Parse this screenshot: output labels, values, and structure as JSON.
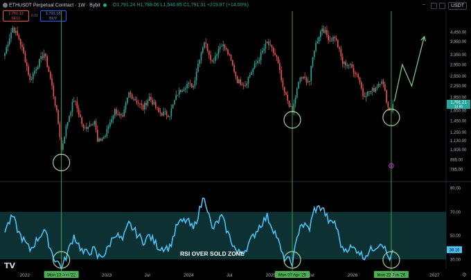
{
  "header": {
    "symbol": "ETHUSDT Perpetual Contract · 1W · Bybit",
    "ohlc": "O1,791.24 H1,788.06 L1,546.85 C1,791.31 +219.97 (+14.00%)"
  },
  "trade": {
    "sell_price": "1,791.13",
    "sell_label": "SELL",
    "buy_price": "1,791.18",
    "buy_label": "BUY",
    "spread": "0.01"
  },
  "toolbar": {
    "currency": "USDT",
    "minus": "−"
  },
  "settings_icon": "gear-icon",
  "colors": {
    "up": "#26a69a",
    "down": "#ef5350",
    "rsi": "#4fc3f7",
    "zone": "#0f3a3c",
    "vline": "#4caf50",
    "circle": "#a5d6a7",
    "arrow": "#81c784",
    "badge": "#4caf50",
    "pink": "#e040fb"
  },
  "chart_data": [
    {
      "type": "candlestick",
      "scale": "log",
      "ylim": [
        695,
        5600
      ],
      "y_ticks": [
        4450,
        3950,
        3350,
        2950,
        2550,
        2250,
        1950,
        1650,
        1450,
        1250,
        1130,
        1005,
        885,
        785
      ],
      "y_tick_labels": [
        "4,450.00",
        "3,950.00",
        "3,350.00",
        "2,950.00",
        "2,550.00",
        "2,250.00",
        "1,950.00",
        "1,650.00",
        "1,450.00",
        "1,250.00",
        "1,130.00",
        "1,005.00",
        "885.00",
        "785.00"
      ],
      "current_price": "1,791.21",
      "countdown": "1d 8h",
      "xlim": [
        "2021-10-01",
        "2027-02-15"
      ],
      "x_ticks": [
        "2022-01-01",
        "2022-07-01",
        "2023-01-01",
        "2023-07-01",
        "2024-01-01",
        "2024-07-01",
        "2025-01-01",
        "2025-07-01",
        "2026-01-01",
        "2026-07-01",
        "2027-01-01"
      ],
      "x_tick_labels": [
        "2022",
        "Jul",
        "2023",
        "Jul",
        "2024",
        "Jul",
        "2025",
        "Jul",
        "2026",
        "Jul",
        "2027"
      ],
      "anchors": [
        [
          "2021-10-04",
          3400
        ],
        [
          "2021-11-08",
          4700
        ],
        [
          "2021-12-06",
          4100
        ],
        [
          "2022-01-24",
          2400
        ],
        [
          "2022-03-28",
          3400
        ],
        [
          "2022-05-09",
          2000
        ],
        [
          "2022-06-13",
          1000
        ],
        [
          "2022-06-20",
          1100
        ],
        [
          "2022-08-08",
          1900
        ],
        [
          "2022-09-19",
          1300
        ],
        [
          "2022-11-07",
          1450
        ],
        [
          "2022-11-21",
          1100
        ],
        [
          "2022-12-26",
          1200
        ],
        [
          "2023-02-06",
          1650
        ],
        [
          "2023-03-13",
          1480
        ],
        [
          "2023-04-10",
          2050
        ],
        [
          "2023-06-12",
          1700
        ],
        [
          "2023-07-10",
          1950
        ],
        [
          "2023-08-21",
          1600
        ],
        [
          "2023-10-09",
          1570
        ],
        [
          "2023-11-13",
          2050
        ],
        [
          "2023-12-25",
          2300
        ],
        [
          "2024-01-22",
          2250
        ],
        [
          "2024-03-11",
          3950
        ],
        [
          "2024-04-15",
          3050
        ],
        [
          "2024-05-27",
          3850
        ],
        [
          "2024-06-24",
          3400
        ],
        [
          "2024-08-05",
          2400
        ],
        [
          "2024-09-09",
          2300
        ],
        [
          "2024-11-11",
          3200
        ],
        [
          "2024-12-16",
          3900
        ],
        [
          "2025-01-27",
          3200
        ],
        [
          "2025-02-24",
          2150
        ],
        [
          "2025-04-07",
          1600
        ],
        [
          "2025-05-12",
          2500
        ],
        [
          "2025-06-23",
          2400
        ],
        [
          "2025-07-14",
          3600
        ],
        [
          "2025-08-18",
          4700
        ],
        [
          "2025-09-22",
          4000
        ],
        [
          "2025-10-13",
          4200
        ],
        [
          "2025-11-17",
          3000
        ],
        [
          "2025-12-15",
          2950
        ],
        [
          "2026-01-26",
          2550
        ],
        [
          "2026-02-16",
          2000
        ],
        [
          "2026-04-06",
          2150
        ],
        [
          "2026-05-11",
          2450
        ],
        [
          "2026-06-08",
          1700
        ],
        [
          "2026-06-22",
          1650
        ],
        [
          "2026-06-29",
          1791
        ]
      ],
      "projection": [
        [
          "2026-07-06",
          1850
        ],
        [
          "2026-08-10",
          2950
        ],
        [
          "2026-09-21",
          2250
        ],
        [
          "2026-11-16",
          4200
        ]
      ],
      "extra_label": "8"
    },
    {
      "type": "line",
      "series": [
        {
          "name": "RSI",
          "last_value": "38.16"
        }
      ],
      "ylim": [
        22,
        92
      ],
      "y_ticks": [
        90,
        70,
        50,
        30
      ],
      "y_tick_labels": [
        "90.00",
        "70.00",
        "50.00",
        "30.00"
      ],
      "oversold_zone": [
        30,
        70
      ],
      "annotation": "RSI OVER SOLD ZONE",
      "anchors": [
        [
          "2021-10-04",
          55
        ],
        [
          "2021-11-08",
          66
        ],
        [
          "2021-12-06",
          52
        ],
        [
          "2022-01-24",
          38
        ],
        [
          "2022-03-28",
          55
        ],
        [
          "2022-05-09",
          32
        ],
        [
          "2022-06-13",
          24
        ],
        [
          "2022-06-20",
          25
        ],
        [
          "2022-08-08",
          50
        ],
        [
          "2022-09-19",
          35
        ],
        [
          "2022-11-07",
          38
        ],
        [
          "2022-11-21",
          32
        ],
        [
          "2022-12-26",
          35
        ],
        [
          "2023-02-06",
          52
        ],
        [
          "2023-03-13",
          46
        ],
        [
          "2023-04-10",
          60
        ],
        [
          "2023-06-12",
          45
        ],
        [
          "2023-07-10",
          50
        ],
        [
          "2023-08-21",
          40
        ],
        [
          "2023-10-09",
          40
        ],
        [
          "2023-11-13",
          60
        ],
        [
          "2023-12-25",
          63
        ],
        [
          "2024-01-22",
          55
        ],
        [
          "2024-03-11",
          84
        ],
        [
          "2024-04-15",
          55
        ],
        [
          "2024-05-27",
          66
        ],
        [
          "2024-06-24",
          52
        ],
        [
          "2024-08-05",
          35
        ],
        [
          "2024-09-09",
          38
        ],
        [
          "2024-11-11",
          58
        ],
        [
          "2024-12-16",
          66
        ],
        [
          "2025-01-27",
          50
        ],
        [
          "2025-02-24",
          32
        ],
        [
          "2025-04-07",
          27
        ],
        [
          "2025-05-12",
          60
        ],
        [
          "2025-06-23",
          56
        ],
        [
          "2025-07-14",
          72
        ],
        [
          "2025-08-18",
          74
        ],
        [
          "2025-09-22",
          60
        ],
        [
          "2025-10-13",
          62
        ],
        [
          "2025-11-17",
          38
        ],
        [
          "2025-12-15",
          40
        ],
        [
          "2026-01-26",
          38
        ],
        [
          "2026-02-16",
          32
        ],
        [
          "2026-04-06",
          40
        ],
        [
          "2026-05-11",
          45
        ],
        [
          "2026-06-08",
          32
        ],
        [
          "2026-06-22",
          31
        ],
        [
          "2026-06-29",
          38
        ]
      ]
    }
  ],
  "vertical_markers": [
    {
      "date": "2022-06-13",
      "label": "Mon 13 Jun '22"
    },
    {
      "date": "2025-04-07",
      "label": "Mon 07 Apr '25"
    },
    {
      "date": "2026-06-22",
      "label": "Mon 22 Jun '26"
    }
  ]
}
